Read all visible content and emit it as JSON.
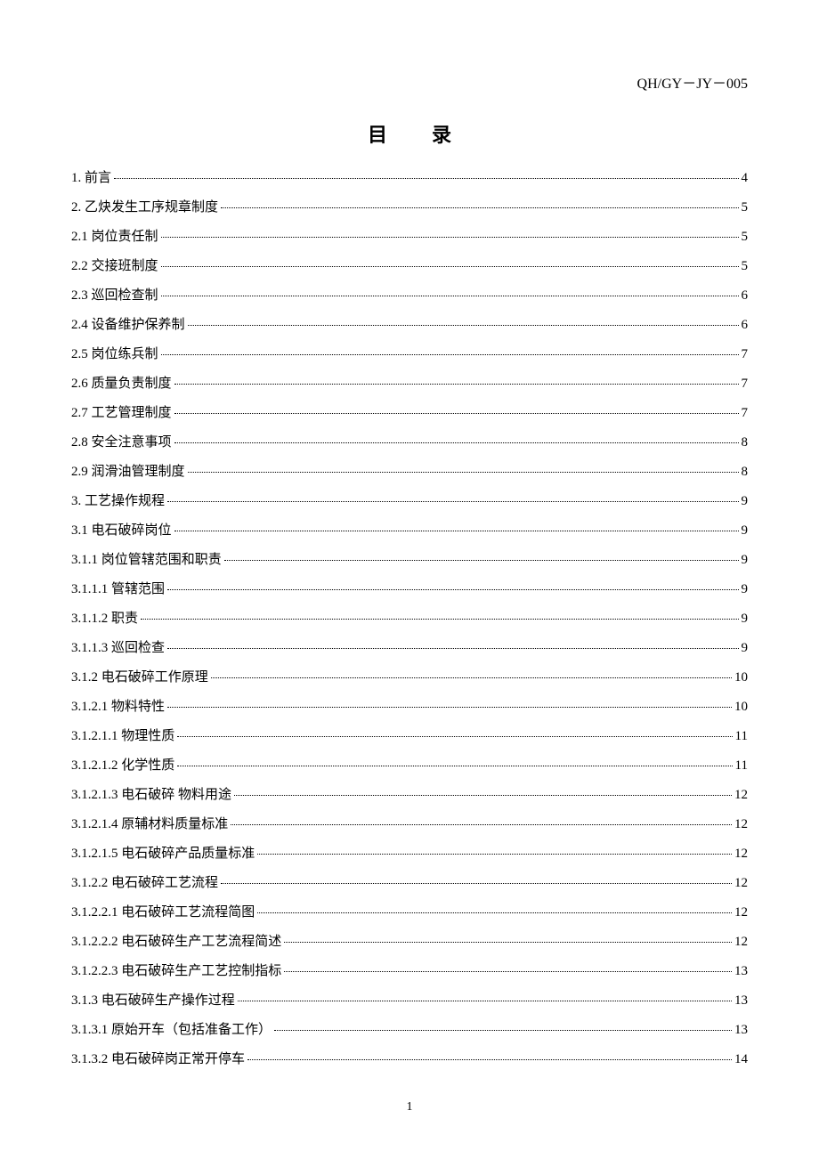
{
  "doc_code": "QH/GY－JY－005",
  "title": "目录",
  "page_number": "1",
  "toc": [
    {
      "label": "1. 前言",
      "page": "4"
    },
    {
      "label": "2. 乙炔发生工序规章制度",
      "page": "5"
    },
    {
      "label": "2.1 岗位责任制",
      "page": "5"
    },
    {
      "label": "2.2 交接班制度",
      "page": "5"
    },
    {
      "label": "2.3 巡回检查制",
      "page": "6"
    },
    {
      "label": "2.4 设备维护保养制",
      "page": "6"
    },
    {
      "label": "2.5 岗位练兵制",
      "page": "7"
    },
    {
      "label": "2.6 质量负责制度",
      "page": "7"
    },
    {
      "label": "2.7 工艺管理制度",
      "page": "7"
    },
    {
      "label": "2.8 安全注意事项",
      "page": "8"
    },
    {
      "label": "2.9 润滑油管理制度",
      "page": "8"
    },
    {
      "label": "3. 工艺操作规程",
      "page": "9"
    },
    {
      "label": "3.1 电石破碎岗位",
      "page": "9"
    },
    {
      "label": "3.1.1 岗位管辖范围和职责",
      "page": "9"
    },
    {
      "label": "3.1.1.1 管辖范围",
      "page": "9"
    },
    {
      "label": "3.1.1.2 职责",
      "page": "9"
    },
    {
      "label": "3.1.1.3 巡回检查",
      "page": "9"
    },
    {
      "label": "3.1.2 电石破碎工作原理",
      "page": "10"
    },
    {
      "label": "3.1.2.1 物料特性",
      "page": "10"
    },
    {
      "label": "3.1.2.1.1 物理性质",
      "page": "11"
    },
    {
      "label": "3.1.2.1.2 化学性质",
      "page": "11"
    },
    {
      "label": "3.1.2.1.3 电石破碎 物料用途",
      "page": "12"
    },
    {
      "label": "3.1.2.1.4 原辅材料质量标准",
      "page": "12"
    },
    {
      "label": "3.1.2.1.5 电石破碎产品质量标准",
      "page": "12"
    },
    {
      "label": "3.1.2.2 电石破碎工艺流程",
      "page": "12"
    },
    {
      "label": "3.1.2.2.1 电石破碎工艺流程简图",
      "page": "12"
    },
    {
      "label": "3.1.2.2.2 电石破碎生产工艺流程简述",
      "page": "12"
    },
    {
      "label": "3.1.2.2.3 电石破碎生产工艺控制指标",
      "page": "13"
    },
    {
      "label": "3.1.3 电石破碎生产操作过程",
      "page": "13"
    },
    {
      "label": "3.1.3.1 原始开车（包括准备工作）",
      "page": "13"
    },
    {
      "label": "3.1.3.2 电石破碎岗正常开停车",
      "page": "14"
    }
  ]
}
